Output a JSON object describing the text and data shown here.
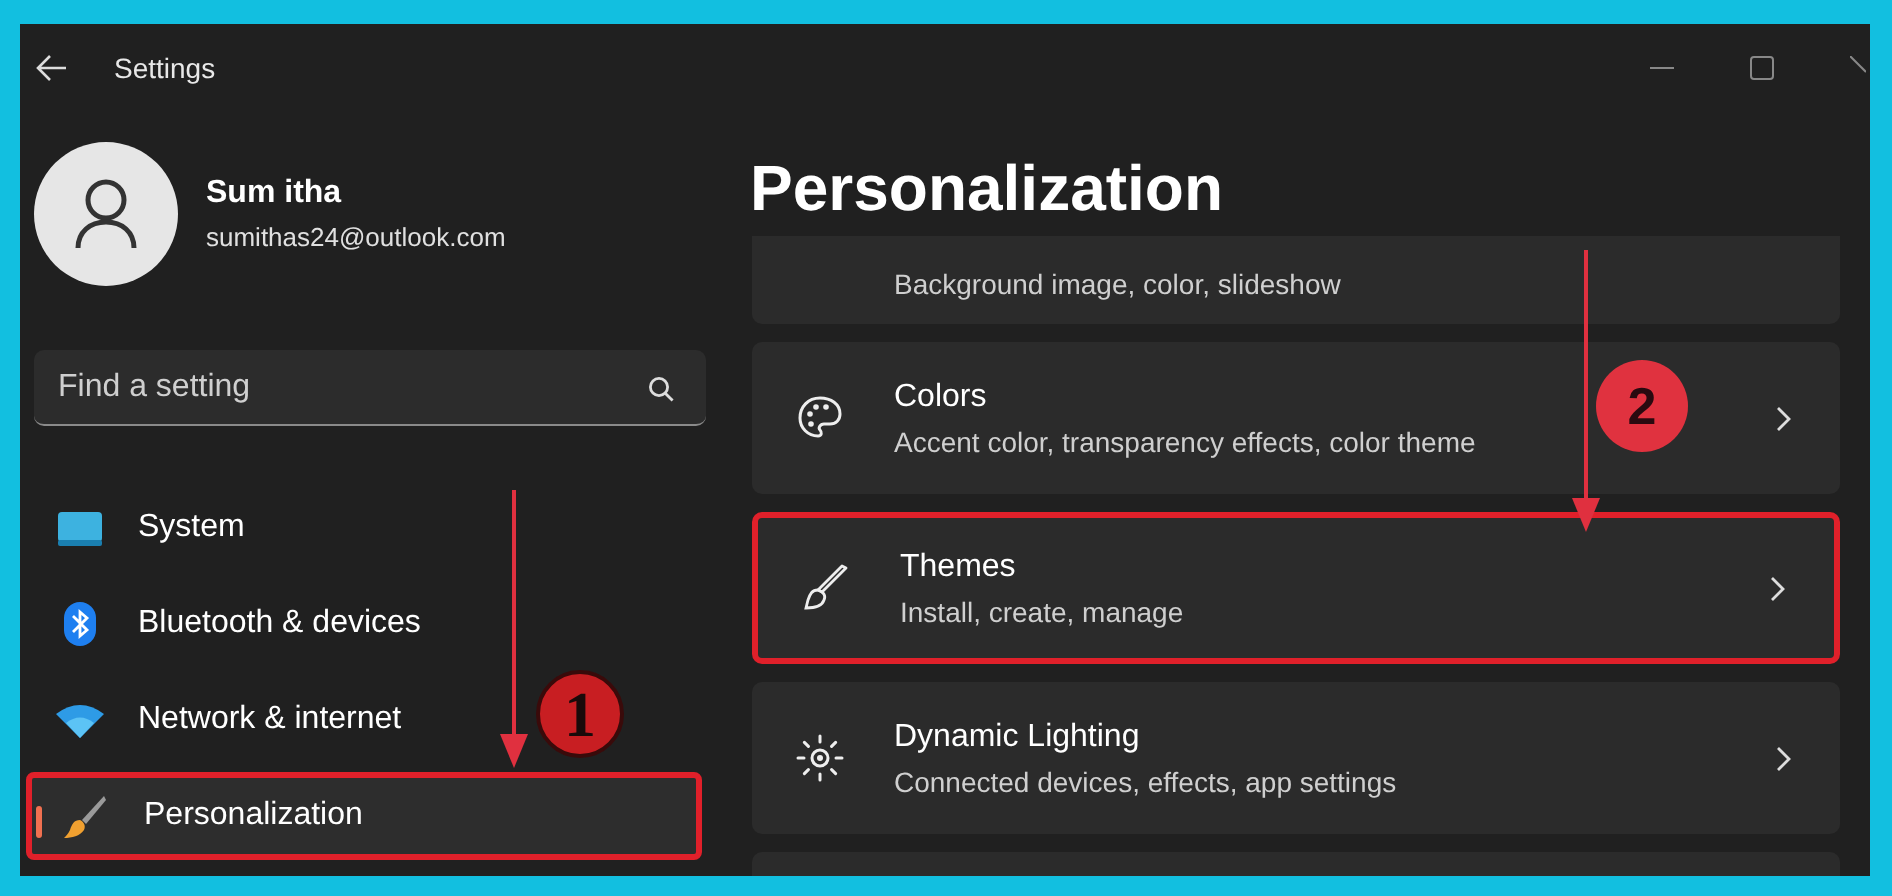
{
  "window": {
    "title": "Settings"
  },
  "account": {
    "name": "Sum itha",
    "email": "sumithas24@outlook.com"
  },
  "search": {
    "placeholder": "Find a setting"
  },
  "nav": [
    {
      "label": "System",
      "selected": false,
      "highlighted": false
    },
    {
      "label": "Bluetooth & devices",
      "selected": false,
      "highlighted": false
    },
    {
      "label": "Network & internet",
      "selected": false,
      "highlighted": false
    },
    {
      "label": "Personalization",
      "selected": true,
      "highlighted": true
    }
  ],
  "page": {
    "title": "Personalization"
  },
  "cards": [
    {
      "subtitle": "Background image, color, slideshow",
      "highlighted": false
    },
    {
      "title": "Colors",
      "subtitle": "Accent color, transparency effects, color theme",
      "highlighted": false
    },
    {
      "title": "Themes",
      "subtitle": "Install, create, manage",
      "highlighted": true
    },
    {
      "title": "Dynamic Lighting",
      "subtitle": "Connected devices, effects, app settings",
      "highlighted": false
    }
  ],
  "annotations": [
    {
      "label": "1"
    },
    {
      "label": "2"
    }
  ]
}
